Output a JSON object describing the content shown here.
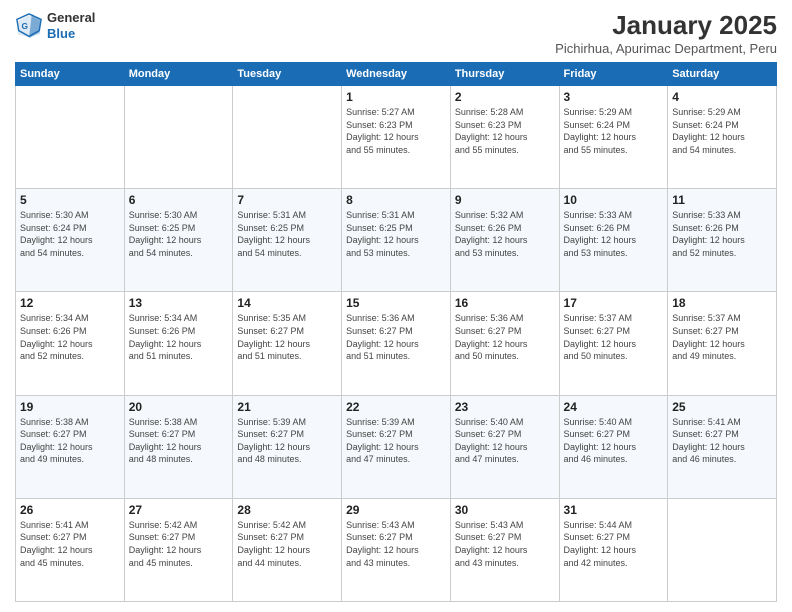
{
  "header": {
    "logo_line1": "General",
    "logo_line2": "Blue",
    "title": "January 2025",
    "subtitle": "Pichirhua, Apurimac Department, Peru"
  },
  "days_of_week": [
    "Sunday",
    "Monday",
    "Tuesday",
    "Wednesday",
    "Thursday",
    "Friday",
    "Saturday"
  ],
  "weeks": [
    [
      {
        "day": "",
        "info": ""
      },
      {
        "day": "",
        "info": ""
      },
      {
        "day": "",
        "info": ""
      },
      {
        "day": "1",
        "info": "Sunrise: 5:27 AM\nSunset: 6:23 PM\nDaylight: 12 hours\nand 55 minutes."
      },
      {
        "day": "2",
        "info": "Sunrise: 5:28 AM\nSunset: 6:23 PM\nDaylight: 12 hours\nand 55 minutes."
      },
      {
        "day": "3",
        "info": "Sunrise: 5:29 AM\nSunset: 6:24 PM\nDaylight: 12 hours\nand 55 minutes."
      },
      {
        "day": "4",
        "info": "Sunrise: 5:29 AM\nSunset: 6:24 PM\nDaylight: 12 hours\nand 54 minutes."
      }
    ],
    [
      {
        "day": "5",
        "info": "Sunrise: 5:30 AM\nSunset: 6:24 PM\nDaylight: 12 hours\nand 54 minutes."
      },
      {
        "day": "6",
        "info": "Sunrise: 5:30 AM\nSunset: 6:25 PM\nDaylight: 12 hours\nand 54 minutes."
      },
      {
        "day": "7",
        "info": "Sunrise: 5:31 AM\nSunset: 6:25 PM\nDaylight: 12 hours\nand 54 minutes."
      },
      {
        "day": "8",
        "info": "Sunrise: 5:31 AM\nSunset: 6:25 PM\nDaylight: 12 hours\nand 53 minutes."
      },
      {
        "day": "9",
        "info": "Sunrise: 5:32 AM\nSunset: 6:26 PM\nDaylight: 12 hours\nand 53 minutes."
      },
      {
        "day": "10",
        "info": "Sunrise: 5:33 AM\nSunset: 6:26 PM\nDaylight: 12 hours\nand 53 minutes."
      },
      {
        "day": "11",
        "info": "Sunrise: 5:33 AM\nSunset: 6:26 PM\nDaylight: 12 hours\nand 52 minutes."
      }
    ],
    [
      {
        "day": "12",
        "info": "Sunrise: 5:34 AM\nSunset: 6:26 PM\nDaylight: 12 hours\nand 52 minutes."
      },
      {
        "day": "13",
        "info": "Sunrise: 5:34 AM\nSunset: 6:26 PM\nDaylight: 12 hours\nand 51 minutes."
      },
      {
        "day": "14",
        "info": "Sunrise: 5:35 AM\nSunset: 6:27 PM\nDaylight: 12 hours\nand 51 minutes."
      },
      {
        "day": "15",
        "info": "Sunrise: 5:36 AM\nSunset: 6:27 PM\nDaylight: 12 hours\nand 51 minutes."
      },
      {
        "day": "16",
        "info": "Sunrise: 5:36 AM\nSunset: 6:27 PM\nDaylight: 12 hours\nand 50 minutes."
      },
      {
        "day": "17",
        "info": "Sunrise: 5:37 AM\nSunset: 6:27 PM\nDaylight: 12 hours\nand 50 minutes."
      },
      {
        "day": "18",
        "info": "Sunrise: 5:37 AM\nSunset: 6:27 PM\nDaylight: 12 hours\nand 49 minutes."
      }
    ],
    [
      {
        "day": "19",
        "info": "Sunrise: 5:38 AM\nSunset: 6:27 PM\nDaylight: 12 hours\nand 49 minutes."
      },
      {
        "day": "20",
        "info": "Sunrise: 5:38 AM\nSunset: 6:27 PM\nDaylight: 12 hours\nand 48 minutes."
      },
      {
        "day": "21",
        "info": "Sunrise: 5:39 AM\nSunset: 6:27 PM\nDaylight: 12 hours\nand 48 minutes."
      },
      {
        "day": "22",
        "info": "Sunrise: 5:39 AM\nSunset: 6:27 PM\nDaylight: 12 hours\nand 47 minutes."
      },
      {
        "day": "23",
        "info": "Sunrise: 5:40 AM\nSunset: 6:27 PM\nDaylight: 12 hours\nand 47 minutes."
      },
      {
        "day": "24",
        "info": "Sunrise: 5:40 AM\nSunset: 6:27 PM\nDaylight: 12 hours\nand 46 minutes."
      },
      {
        "day": "25",
        "info": "Sunrise: 5:41 AM\nSunset: 6:27 PM\nDaylight: 12 hours\nand 46 minutes."
      }
    ],
    [
      {
        "day": "26",
        "info": "Sunrise: 5:41 AM\nSunset: 6:27 PM\nDaylight: 12 hours\nand 45 minutes."
      },
      {
        "day": "27",
        "info": "Sunrise: 5:42 AM\nSunset: 6:27 PM\nDaylight: 12 hours\nand 45 minutes."
      },
      {
        "day": "28",
        "info": "Sunrise: 5:42 AM\nSunset: 6:27 PM\nDaylight: 12 hours\nand 44 minutes."
      },
      {
        "day": "29",
        "info": "Sunrise: 5:43 AM\nSunset: 6:27 PM\nDaylight: 12 hours\nand 43 minutes."
      },
      {
        "day": "30",
        "info": "Sunrise: 5:43 AM\nSunset: 6:27 PM\nDaylight: 12 hours\nand 43 minutes."
      },
      {
        "day": "31",
        "info": "Sunrise: 5:44 AM\nSunset: 6:27 PM\nDaylight: 12 hours\nand 42 minutes."
      },
      {
        "day": "",
        "info": ""
      }
    ]
  ]
}
